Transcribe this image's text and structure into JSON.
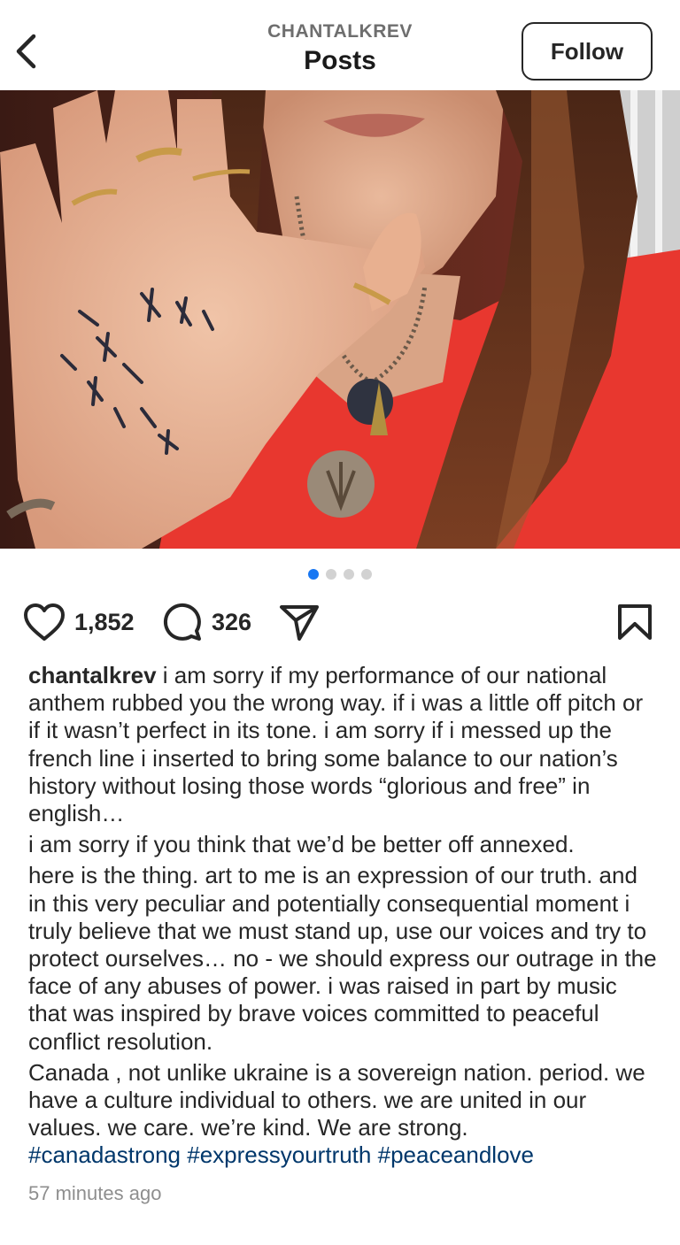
{
  "header": {
    "username": "CHANTALKREV",
    "title": "Posts",
    "follow_label": "Follow"
  },
  "carousel": {
    "total": 4,
    "active_index": 0
  },
  "actions": {
    "likes": "1,852",
    "comments": "326"
  },
  "caption": {
    "username": "chantalkrev",
    "paragraphs": [
      "i am sorry if my performance of our national anthem rubbed you the wrong way. if i was a little off pitch or if it wasn’t perfect in its tone. i am sorry if i messed up the french line i inserted to bring some balance to our nation’s history without losing those words “glorious and free” in english…",
      "i am sorry if you think that we’d be better off annexed.",
      "here is the thing. art to me is an expression of our truth. and in this very peculiar and potentially consequential moment i truly believe that we must stand up, use our voices and try to protect ourselves… no - we should express our outrage in the face of any abuses of power. i was raised in part by music that was inspired by brave voices committed to peaceful conflict resolution.",
      "Canada , not unlike ukraine is a sovereign nation. period. we have a culture individual to others. we are united in our values. we care. we’re kind. We are strong."
    ],
    "hashtags": [
      "#canadastrong",
      "#expressyourtruth",
      "#peaceandlove"
    ]
  },
  "timestamp": "57 minutes ago",
  "colors": {
    "link": "#00376b",
    "active_dot": "#1877f2",
    "shirt": "#e8372f"
  },
  "icons": [
    "back-chevron-icon",
    "heart-icon",
    "comment-icon",
    "share-icon",
    "bookmark-icon"
  ]
}
